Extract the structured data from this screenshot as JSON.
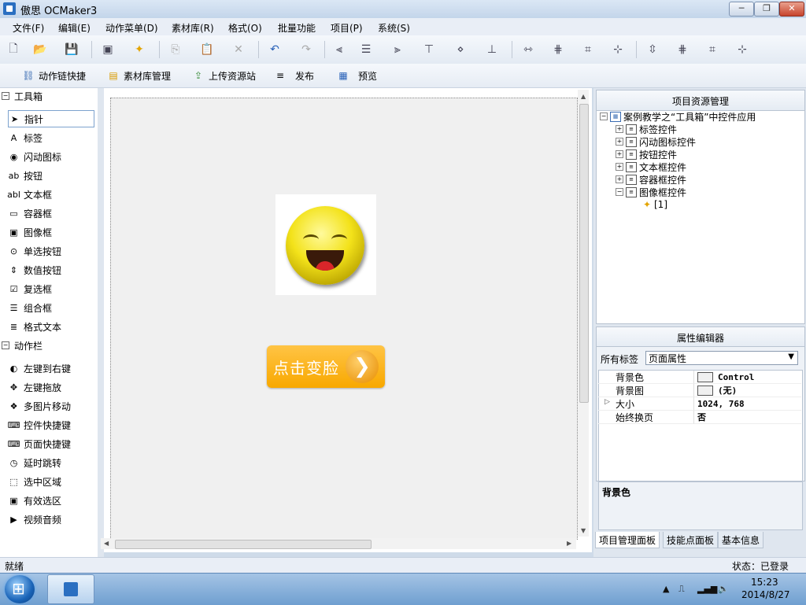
{
  "window": {
    "title": "傲思 OCMaker3",
    "min": "─",
    "max": "❐",
    "close": "✕"
  },
  "menu": [
    "文件(F)",
    "编辑(E)",
    "动作菜单(D)",
    "素材库(R)",
    "格式(O)",
    "批量功能",
    "项目(P)",
    "系统(S)"
  ],
  "toolbar2": [
    {
      "label": "动作链快捷",
      "icon": "action-chain-icon"
    },
    {
      "label": "素材库管理",
      "icon": "material-library-icon"
    },
    {
      "label": "上传资源站",
      "icon": "upload-icon"
    },
    {
      "label": "发布",
      "icon": "publish-icon"
    },
    {
      "label": "预览",
      "icon": "preview-icon"
    }
  ],
  "toolbox": {
    "section_tools": "工具箱",
    "tools": [
      {
        "label": "指针",
        "icon": "pointer-icon",
        "glyph": "➤",
        "selected": true
      },
      {
        "label": "标签",
        "icon": "label-icon",
        "glyph": "A"
      },
      {
        "label": "闪动图标",
        "icon": "flash-icon",
        "glyph": "◉"
      },
      {
        "label": "按钮",
        "icon": "button-icon",
        "glyph": "ab"
      },
      {
        "label": "文本框",
        "icon": "textbox-icon",
        "glyph": "abl"
      },
      {
        "label": "容器框",
        "icon": "container-icon",
        "glyph": "▭"
      },
      {
        "label": "图像框",
        "icon": "image-icon",
        "glyph": "▣"
      },
      {
        "label": "单选按钮",
        "icon": "radio-icon",
        "glyph": "⊙"
      },
      {
        "label": "数值按钮",
        "icon": "numeric-icon",
        "glyph": "⇕"
      },
      {
        "label": "复选框",
        "icon": "checkbox-icon",
        "glyph": "☑"
      },
      {
        "label": "组合框",
        "icon": "combobox-icon",
        "glyph": "☰"
      },
      {
        "label": "格式文本",
        "icon": "richtext-icon",
        "glyph": "≣"
      }
    ],
    "section_actions": "动作栏",
    "actions": [
      {
        "label": "左键到右键",
        "icon": "mouse-icon",
        "glyph": "◐"
      },
      {
        "label": "左键拖放",
        "icon": "drag-icon",
        "glyph": "✥"
      },
      {
        "label": "多图片移动",
        "icon": "multi-image-icon",
        "glyph": "❖"
      },
      {
        "label": "控件快捷键",
        "icon": "control-hotkey-icon",
        "glyph": "⌨"
      },
      {
        "label": "页面快捷键",
        "icon": "page-hotkey-icon",
        "glyph": "⌨"
      },
      {
        "label": "延时跳转",
        "icon": "timer-icon",
        "glyph": "◷"
      },
      {
        "label": "选中区域",
        "icon": "select-area-icon",
        "glyph": "⬚"
      },
      {
        "label": "有效选区",
        "icon": "valid-area-icon",
        "glyph": "▣"
      },
      {
        "label": "视频音频",
        "icon": "media-icon",
        "glyph": "▶"
      }
    ]
  },
  "canvas": {
    "button_label": "点击变脸",
    "button_arrow": "❯"
  },
  "project_panel": {
    "title": "项目资源管理",
    "root": "案例教学之“工具箱”中控件应用",
    "nodes": [
      "标签控件",
      "闪动图标控件",
      "按钮控件",
      "文本框控件",
      "容器框控件",
      "图像框控件"
    ],
    "child": "[1]"
  },
  "property_panel": {
    "title": "属性编辑器",
    "filter_label": "所有标签",
    "filter_value": "页面属性",
    "rows": [
      {
        "key": "背景色",
        "value": "Control",
        "swatch": true
      },
      {
        "key": "背景图",
        "value": "(无)",
        "swatch": true
      },
      {
        "key": "大小",
        "value": "1024, 768",
        "expandable": true
      },
      {
        "key": "始终换页",
        "value": "否"
      }
    ],
    "description": "背景色"
  },
  "tabs": [
    "项目管理面板",
    "技能点面板",
    "基本信息"
  ],
  "status": {
    "left": "就绪",
    "right": "状态：已登录"
  },
  "taskbar": {
    "time": "15:23",
    "date": "2014/8/27"
  }
}
